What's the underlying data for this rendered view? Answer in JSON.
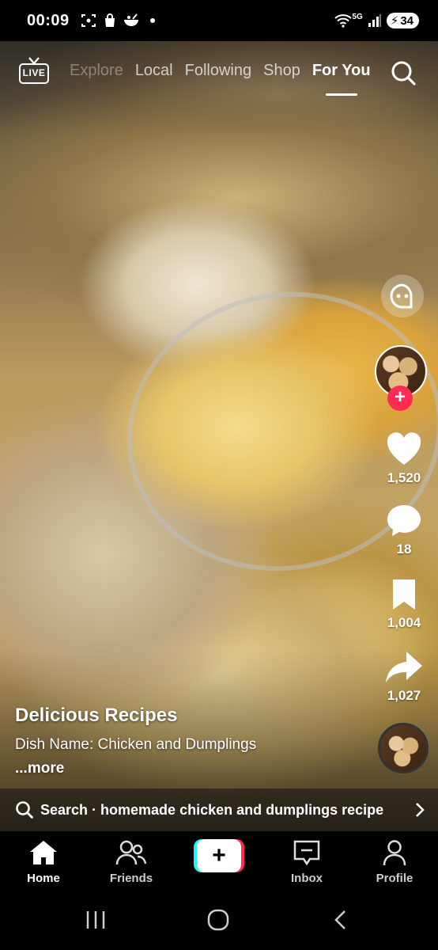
{
  "status_bar": {
    "time": "00:09",
    "network": "5G",
    "battery": "34",
    "icons": [
      "screenshot-icon",
      "shopping-bag-icon",
      "food-bowl-icon",
      "notification-dot"
    ]
  },
  "top_nav": {
    "live_label": "LIVE",
    "tabs": [
      {
        "label": "Explore",
        "active": false
      },
      {
        "label": "Local",
        "active": false
      },
      {
        "label": "Following",
        "active": false
      },
      {
        "label": "Shop",
        "active": false
      },
      {
        "label": "For You",
        "active": true
      }
    ],
    "search_icon": "search-icon"
  },
  "right_rail": {
    "like_count": "1,520",
    "comment_count": "18",
    "bookmark_count": "1,004",
    "share_count": "1,027"
  },
  "caption": {
    "author": "Delicious Recipes",
    "description": "Dish Name: Chicken and Dumplings",
    "more_label": "...more"
  },
  "search_suggestion": {
    "text": "Search · homemade chicken and dumplings recipe"
  },
  "bottom_nav": {
    "items": [
      {
        "label": "Home",
        "active": true
      },
      {
        "label": "Friends",
        "active": false
      },
      {
        "label": "Inbox",
        "active": false
      },
      {
        "label": "Profile",
        "active": false
      }
    ],
    "create_label": "+"
  },
  "colors": {
    "accent_red": "#fe2c55",
    "accent_cyan": "#25f4ee",
    "background": "#000000",
    "text": "#ffffff"
  }
}
